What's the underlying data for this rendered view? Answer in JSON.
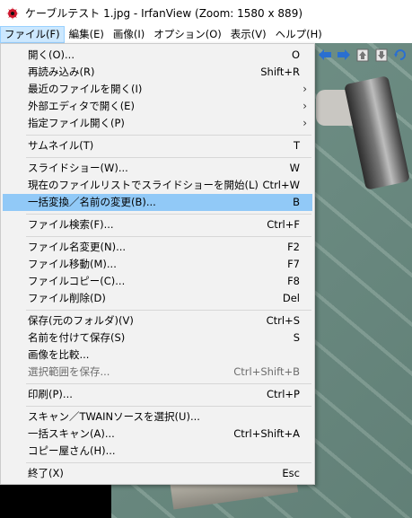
{
  "window": {
    "title": "ケーブルテスト 1.jpg - IrfanView (Zoom: 1580 x 889)"
  },
  "menubar": [
    {
      "label": "ファイル(F)",
      "active": true
    },
    {
      "label": "編集(E)"
    },
    {
      "label": "画像(I)"
    },
    {
      "label": "オプション(O)"
    },
    {
      "label": "表示(V)"
    },
    {
      "label": "ヘルプ(H)"
    }
  ],
  "toolbar": {
    "icons": [
      "arrow-left-icon",
      "arrow-right-icon",
      "page-up-icon",
      "page-down-icon",
      "rotate-icon"
    ]
  },
  "file_menu": {
    "items": [
      {
        "label": "開く(O)...",
        "shortcut": "O"
      },
      {
        "label": "再読み込み(R)",
        "shortcut": "Shift+R"
      },
      {
        "label": "最近のファイルを開く(I)",
        "submenu": true
      },
      {
        "label": "外部エディタで開く(E)",
        "submenu": true
      },
      {
        "label": "指定ファイル開く(P)",
        "submenu": true
      },
      {
        "label": "サムネイル(T)",
        "shortcut": "T"
      },
      {
        "label": "スライドショー(W)...",
        "shortcut": "W"
      },
      {
        "label": "現在のファイルリストでスライドショーを開始(L)",
        "shortcut": "Ctrl+W"
      },
      {
        "label": "一括変換／名前の変更(B)...",
        "shortcut": "B",
        "highlighted": true
      },
      {
        "label": "ファイル検索(F)...",
        "shortcut": "Ctrl+F"
      },
      {
        "label": "ファイル名変更(N)...",
        "shortcut": "F2"
      },
      {
        "label": "ファイル移動(M)...",
        "shortcut": "F7"
      },
      {
        "label": "ファイルコピー(C)...",
        "shortcut": "F8"
      },
      {
        "label": "ファイル削除(D)",
        "shortcut": "Del"
      },
      {
        "label": "保存(元のフォルダ)(V)",
        "shortcut": "Ctrl+S"
      },
      {
        "label": "名前を付けて保存(S)",
        "shortcut": "S"
      },
      {
        "label": "画像を比較..."
      },
      {
        "label": "選択範囲を保存...",
        "shortcut": "Ctrl+Shift+B",
        "disabled": true
      },
      {
        "label": "印刷(P)...",
        "shortcut": "Ctrl+P"
      },
      {
        "label": "スキャン／TWAINソースを選択(U)..."
      },
      {
        "label": "一括スキャン(A)...",
        "shortcut": "Ctrl+Shift+A"
      },
      {
        "label": "コピー屋さん(H)..."
      },
      {
        "label": "終了(X)",
        "shortcut": "Esc"
      }
    ]
  }
}
